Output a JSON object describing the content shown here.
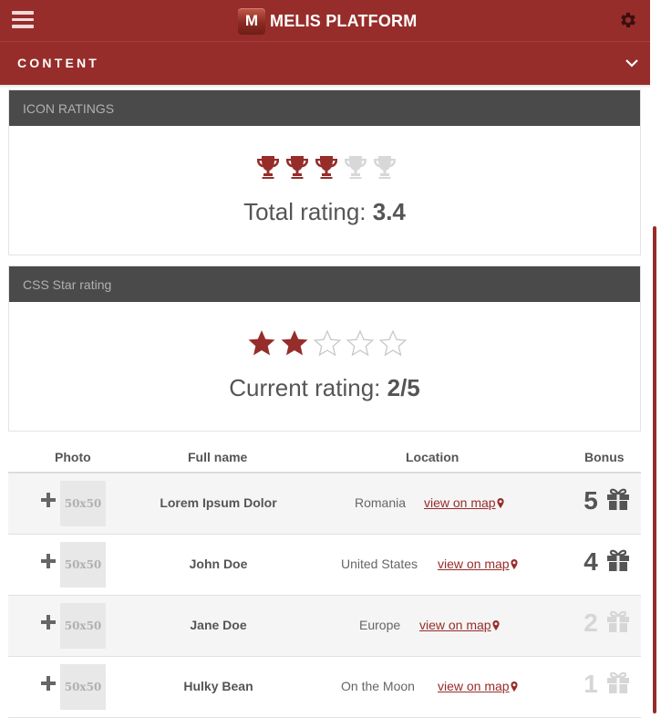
{
  "header": {
    "app_title": "MELIS PLATFORM",
    "logo_letter": "M",
    "section_label": "CONTENT"
  },
  "colors": {
    "brand": "#962d2a",
    "panel_head": "#4a4a4a",
    "active_icon": "#962d2a",
    "inactive_icon": "#d8d8d8"
  },
  "icon_ratings": {
    "title": "ICON RATINGS",
    "icon": "trophy-icon",
    "filled": 3,
    "total": 5,
    "label": "Total rating:",
    "value": "3.4"
  },
  "css_star_rating": {
    "title": "CSS Star rating",
    "icon": "star-icon",
    "filled": 2,
    "total": 5,
    "label": "Current rating:",
    "value": "2/5"
  },
  "table": {
    "headers": {
      "photo": "Photo",
      "full_name": "Full name",
      "location": "Location",
      "bonus": "Bonus"
    },
    "rows": [
      {
        "photo": "50x50",
        "name": "Lorem Ipsum Dolor",
        "location": "Romania",
        "map_link": "view on map",
        "bonus": "5",
        "active": true
      },
      {
        "photo": "50x50",
        "name": "John Doe",
        "location": "United States",
        "map_link": "view on map",
        "bonus": "4",
        "active": true
      },
      {
        "photo": "50x50",
        "name": "Jane Doe",
        "location": "Europe",
        "map_link": "view on map",
        "bonus": "2",
        "active": false
      },
      {
        "photo": "50x50",
        "name": "Hulky Bean",
        "location": "On the Moon",
        "map_link": "view on map",
        "bonus": "1",
        "active": false
      }
    ]
  }
}
